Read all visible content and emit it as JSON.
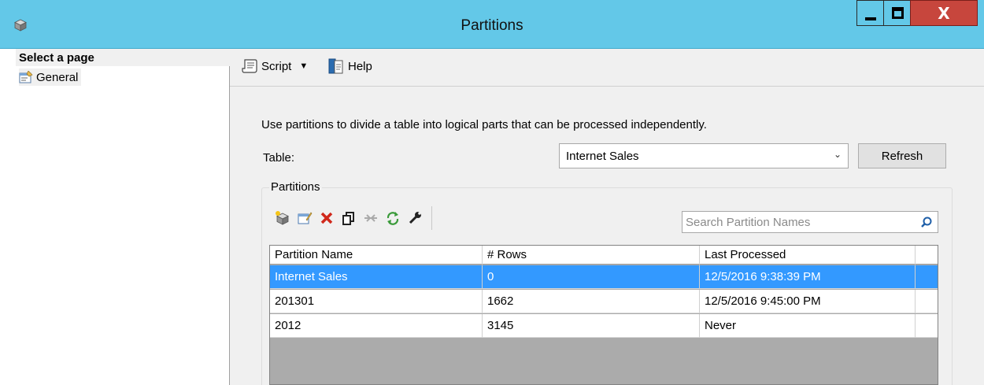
{
  "window": {
    "title": "Partitions",
    "close_glyph": "X"
  },
  "left_pane": {
    "header": "Select a page",
    "items": [
      {
        "label": "General",
        "icon": "properties-page-icon"
      }
    ]
  },
  "toolbar": {
    "script_label": "Script",
    "help_label": "Help"
  },
  "main": {
    "description": "Use partitions to divide a table into logical parts that can be processed independently.",
    "table_label": "Table:",
    "table_value": "Internet Sales",
    "refresh_label": "Refresh",
    "partitions_group_label": "Partitions",
    "search_placeholder": "Search Partition Names"
  },
  "grid": {
    "columns": [
      "Partition Name",
      "# Rows",
      "Last Processed"
    ],
    "rows": [
      {
        "name": "Internet Sales",
        "rows": "0",
        "last_processed": "12/5/2016 9:38:39 PM",
        "selected": true
      },
      {
        "name": "201301",
        "rows": "1662",
        "last_processed": "12/5/2016 9:45:00 PM",
        "selected": false
      },
      {
        "name": "2012",
        "rows": "3145",
        "last_processed": "Never",
        "selected": false
      }
    ]
  },
  "colors": {
    "titlebar": "#63c8e8",
    "close_button": "#c7463d",
    "selection": "#3399ff",
    "grid_empty": "#ababab"
  }
}
